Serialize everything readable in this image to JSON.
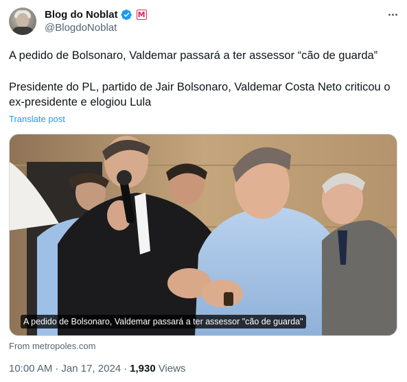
{
  "author": {
    "display_name": "Blog do Noblat",
    "handle": "@BlogdoNoblat",
    "verified": true,
    "badge_letter": "M"
  },
  "tweet": {
    "headline": "A pedido de Bolsonaro, Valdemar passará a ter assessor “cão de guarda”",
    "body": "Presidente do PL, partido de Jair Bolsonaro, Valdemar Costa Neto criticou o ex-presidente e elogiou Lula",
    "translate_label": "Translate post"
  },
  "media": {
    "caption": "A pedido de Bolsonaro, Valdemar passará a ter assessor \"cão de guarda\"",
    "source": "From metropoles.com"
  },
  "meta": {
    "time": "10:00 AM",
    "separator": "·",
    "date": "Jan 17, 2024",
    "views_count": "1,930",
    "views_label": "Views"
  },
  "icons": {
    "verified": "verified-check-icon",
    "more": "more-options-icon"
  },
  "colors": {
    "accent": "#1d9bf0",
    "secondary_text": "#536471",
    "badge_red": "#e0245e"
  }
}
